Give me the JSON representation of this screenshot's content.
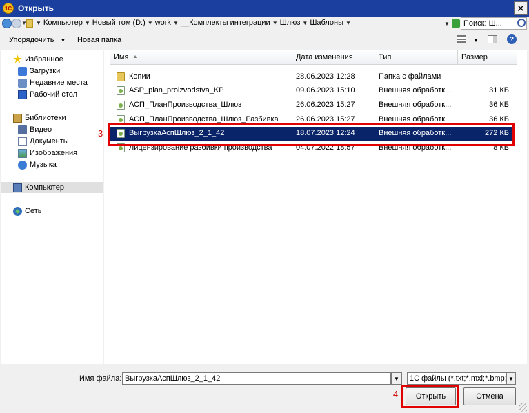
{
  "window": {
    "title": "Открыть",
    "app_icon_text": "1С"
  },
  "address": {
    "crumbs": [
      "Компьютер",
      "Новый том (D:)",
      "work",
      "__Комплекты интеграции",
      "Шлюз",
      "Шаблоны"
    ],
    "search_placeholder": "Поиск: Ш..."
  },
  "toolbar": {
    "organize_label": "Упорядочить",
    "new_folder_label": "Новая папка"
  },
  "nav": {
    "favorites": "Избранное",
    "downloads": "Загрузки",
    "recent": "Недавние места",
    "desktop": "Рабочий стол",
    "libraries": "Библиотеки",
    "video": "Видео",
    "documents": "Документы",
    "images": "Изображения",
    "music": "Музыка",
    "computer": "Компьютер",
    "network": "Сеть"
  },
  "columns": {
    "name": "Имя",
    "date": "Дата изменения",
    "type": "Тип",
    "size": "Размер"
  },
  "files": [
    {
      "name": "Копии",
      "date": "28.06.2023 12:28",
      "type": "Папка с файлами",
      "size": "",
      "icon": "folder-icon"
    },
    {
      "name": "ASP_plan_proizvodstva_KP",
      "date": "09.06.2023 15:10",
      "type": "Внешняя обработк...",
      "size": "31 КБ",
      "icon": "epf-file-icon"
    },
    {
      "name": "АСП_ПланПроизводства_Шлюз",
      "date": "26.06.2023 15:27",
      "type": "Внешняя обработк...",
      "size": "36 КБ",
      "icon": "epf-file-icon"
    },
    {
      "name": "АСП_ПланПроизводства_Шлюз_Разбивка",
      "date": "26.06.2023 15:27",
      "type": "Внешняя обработк...",
      "size": "36 КБ",
      "icon": "epf-file-icon"
    },
    {
      "name": "ВыгрузкаАспШлюз_2_1_42",
      "date": "18.07.2023 12:24",
      "type": "Внешняя обработк...",
      "size": "272 КБ",
      "icon": "epf-file-icon"
    },
    {
      "name": "Лицензирование разбивки производства",
      "date": "04.07.2022 18:57",
      "type": "Внешняя обработк...",
      "size": "8 КБ",
      "icon": "epf-file-icon"
    }
  ],
  "bottom": {
    "filename_label": "Имя файла:",
    "filename_value": "ВыгрузкаАспШлюз_2_1_42",
    "filter_value": "1С файлы (*.txt;*.mxl;*.bmp;",
    "open_label": "Открыть",
    "cancel_label": "Отмена"
  },
  "annotations": {
    "step3": "3",
    "step4": "4"
  },
  "colors": {
    "titlebar": "#1a3f9e",
    "selection": "#0a246a",
    "highlight": "#e00000"
  }
}
